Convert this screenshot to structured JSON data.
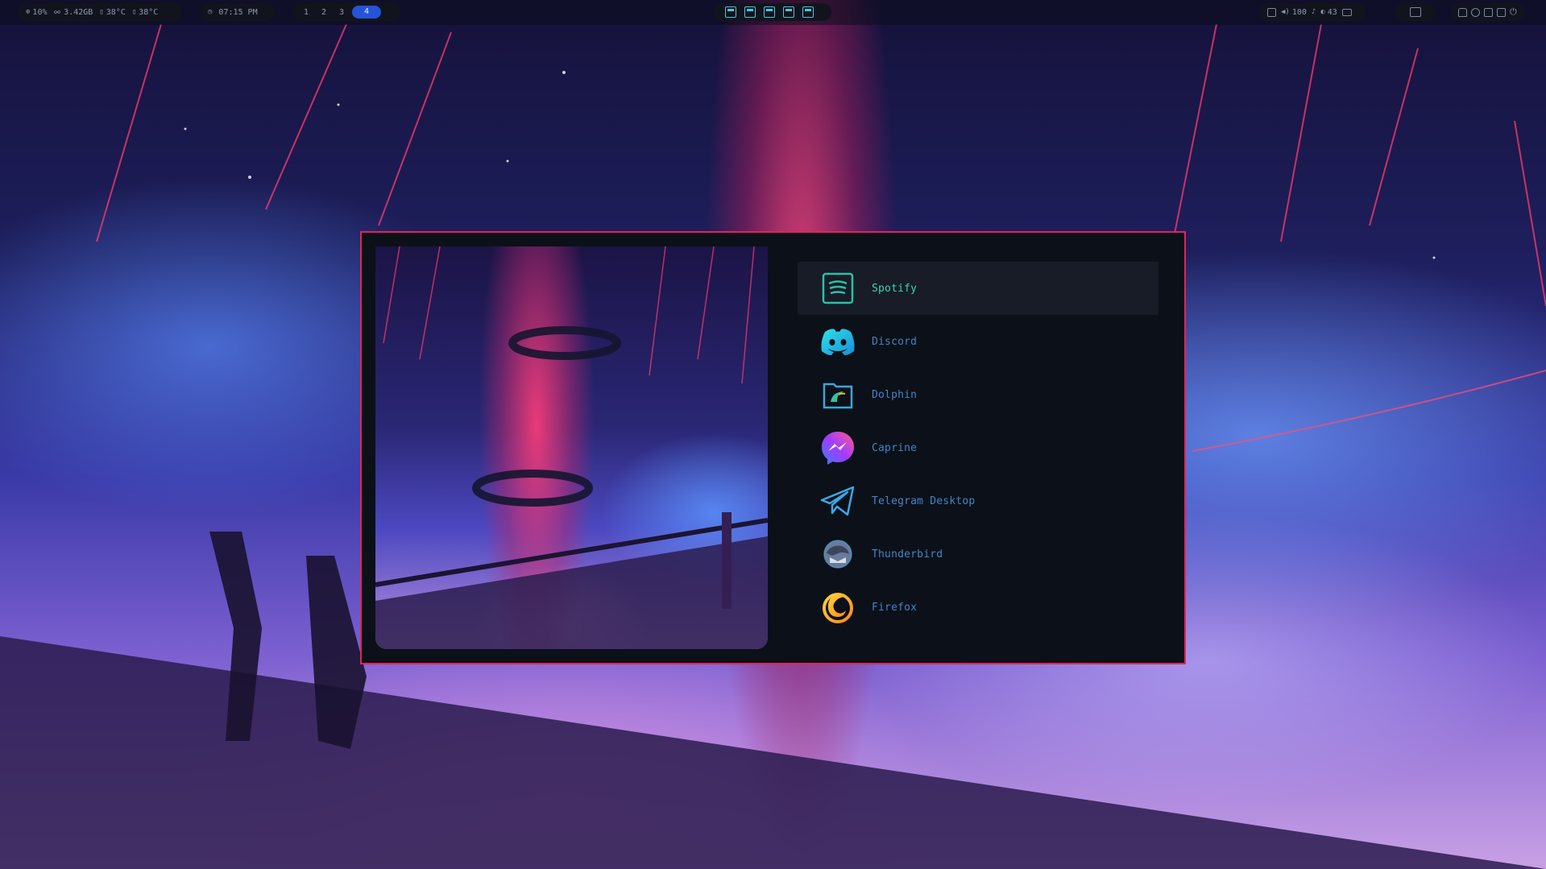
{
  "topbar": {
    "stats": {
      "cpu": "10%",
      "ram": "3.42GB",
      "temp1": "38°C",
      "temp2": "38°C"
    },
    "clock": "07:15 PM",
    "workspaces": [
      "1",
      "2",
      "3",
      "4"
    ],
    "active_workspace": "4",
    "status": {
      "volume": "100",
      "brightness": "43"
    }
  },
  "launcher": {
    "selected_index": 0,
    "apps": [
      {
        "label": "Spotify",
        "icon": "spotify-icon"
      },
      {
        "label": "Discord",
        "icon": "discord-icon"
      },
      {
        "label": "Dolphin",
        "icon": "dolphin-icon"
      },
      {
        "label": "Caprine",
        "icon": "caprine-icon"
      },
      {
        "label": "Telegram Desktop",
        "icon": "telegram-icon"
      },
      {
        "label": "Thunderbird",
        "icon": "thunderbird-icon"
      },
      {
        "label": "Firefox",
        "icon": "firefox-icon"
      }
    ]
  },
  "colors": {
    "accent_border": "#e1245a",
    "workspace_active": "#2554d8",
    "label_color": "#3f86c8",
    "selected_label_color": "#3fd0b8",
    "window_bg": "#0c1018"
  }
}
